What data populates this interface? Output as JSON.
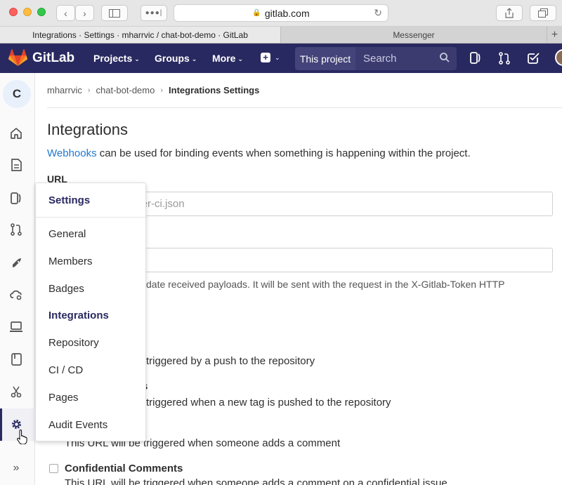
{
  "browser": {
    "url": "gitlab.com",
    "tabs": [
      {
        "title": "Integrations · Settings · mharrvic / chat-bot-demo · GitLab",
        "active": true
      },
      {
        "title": "Messenger",
        "active": false
      }
    ],
    "new_tab": "+"
  },
  "header": {
    "brand": "GitLab",
    "nav": [
      "Projects",
      "Groups",
      "More"
    ],
    "search_scope": "This project",
    "search_placeholder": "Search"
  },
  "sidebar": {
    "project_initial": "C",
    "items": [
      "project-overview",
      "repository",
      "issues",
      "merge-requests",
      "ci-cd",
      "operations",
      "environments",
      "wiki",
      "snippets",
      "settings"
    ],
    "active": "settings",
    "collapse_icon": "»"
  },
  "breadcrumb": {
    "items": [
      "mharrvic",
      "chat-bot-demo",
      "Integrations Settings"
    ]
  },
  "main": {
    "title": "Integrations",
    "lead_link": "Webhooks",
    "lead_rest": " can be used for binding events when something is happening within the project.",
    "url_label": "URL",
    "url_placeholder_visible": "n/trigger-ci.json",
    "token_help_visible": "date received payloads. It will be sent with the request in the X-Gitlab-Token HTTP",
    "trigger1_visible": "triggered by a push to the repository",
    "trigger2_label_visible": "s",
    "trigger2_visible": "triggered when a new tag is pushed to the repository",
    "comments_help": "This URL will be triggered when someone adds a comment",
    "confidential_label": "Confidential Comments",
    "confidential_help": "This URL will be triggered when someone adds a comment on a confidential issue"
  },
  "flyout": {
    "heading": "Settings",
    "items": [
      "General",
      "Members",
      "Badges",
      "Integrations",
      "Repository",
      "CI / CD",
      "Pages",
      "Audit Events"
    ],
    "active": "Integrations"
  },
  "colors": {
    "header_bg": "#292961",
    "link": "#1f78d1",
    "accent": "#292961"
  }
}
